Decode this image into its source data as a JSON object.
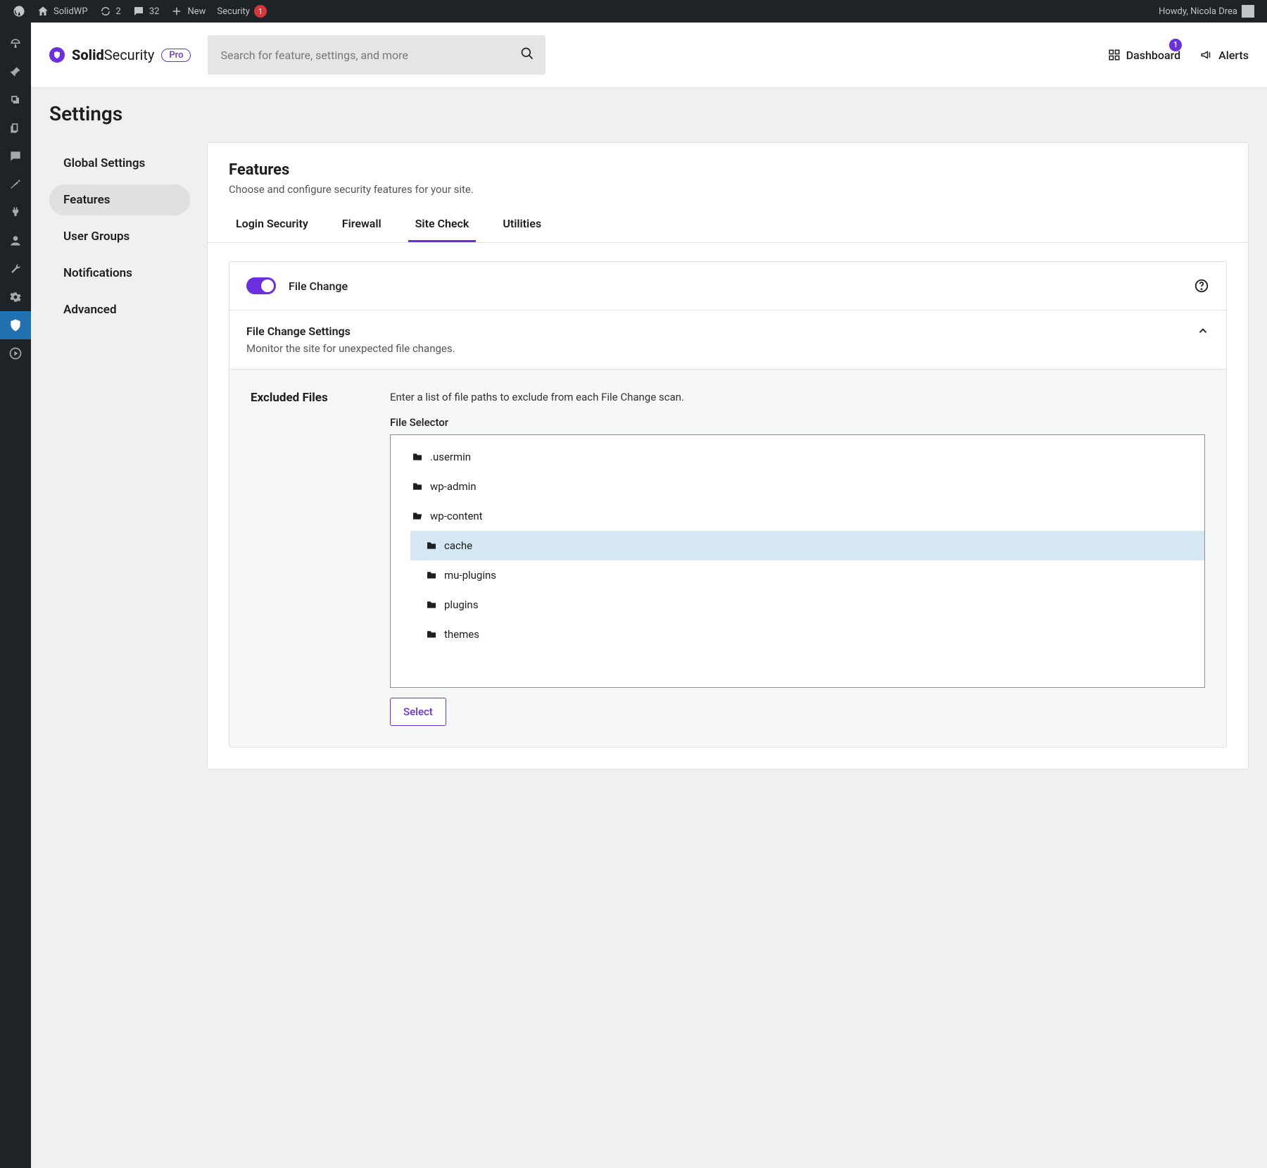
{
  "adminbar": {
    "site_name": "SolidWP",
    "updates_count": "2",
    "comments_count": "32",
    "new_label": "New",
    "security_label": "Security",
    "security_badge": "1",
    "howdy": "Howdy, Nicola Drea"
  },
  "header": {
    "brand_bold": "Solid",
    "brand_light": "Security",
    "pro_badge": "Pro",
    "search_placeholder": "Search for feature, settings, and more",
    "nav_dashboard": "Dashboard",
    "nav_dashboard_badge": "1",
    "nav_alerts": "Alerts"
  },
  "page": {
    "title": "Settings",
    "sidenav": [
      {
        "label": "Global Settings",
        "active": false
      },
      {
        "label": "Features",
        "active": true
      },
      {
        "label": "User Groups",
        "active": false
      },
      {
        "label": "Notifications",
        "active": false
      },
      {
        "label": "Advanced",
        "active": false
      }
    ]
  },
  "panel": {
    "title": "Features",
    "subtitle": "Choose and configure security features for your site.",
    "tabs": [
      {
        "label": "Login Security",
        "active": false
      },
      {
        "label": "Firewall",
        "active": false
      },
      {
        "label": "Site Check",
        "active": true
      },
      {
        "label": "Utilities",
        "active": false
      }
    ],
    "feature_toggle_label": "File Change",
    "settings_title": "File Change Settings",
    "settings_desc": "Monitor the site for unexpected file changes.",
    "excluded_title": "Excluded Files",
    "excluded_desc": "Enter a list of file paths to exclude from each File Change scan.",
    "selector_label": "File Selector",
    "select_button": "Select",
    "file_tree": [
      {
        "label": ".usermin",
        "depth": 0,
        "open": false,
        "selected": false
      },
      {
        "label": "wp-admin",
        "depth": 0,
        "open": false,
        "selected": false
      },
      {
        "label": "wp-content",
        "depth": 0,
        "open": true,
        "selected": false
      },
      {
        "label": "cache",
        "depth": 1,
        "open": false,
        "selected": true
      },
      {
        "label": "mu-plugins",
        "depth": 1,
        "open": false,
        "selected": false
      },
      {
        "label": "plugins",
        "depth": 1,
        "open": false,
        "selected": false
      },
      {
        "label": "themes",
        "depth": 1,
        "open": false,
        "selected": false
      }
    ]
  }
}
